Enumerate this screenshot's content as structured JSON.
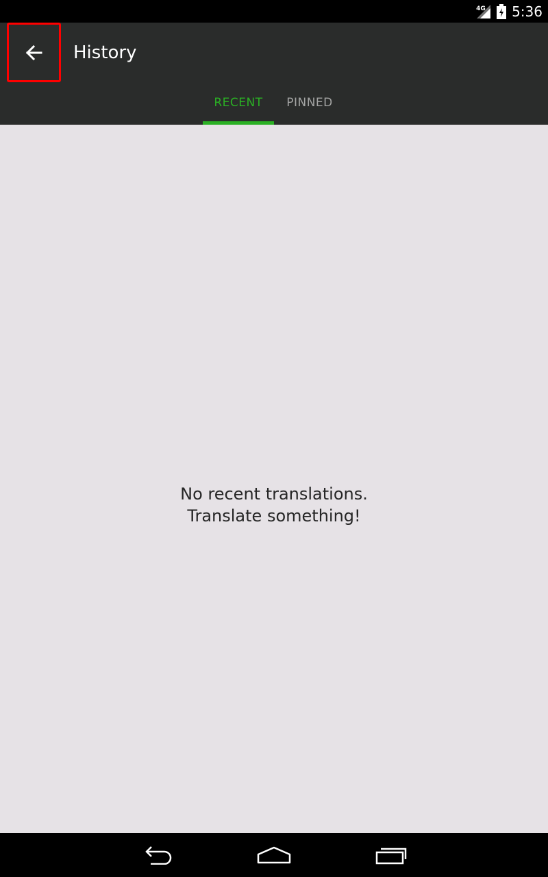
{
  "status_bar": {
    "time": "5:36",
    "network_type": "4G",
    "icons": [
      "signal-icon",
      "battery-icon"
    ]
  },
  "toolbar": {
    "title": "History",
    "back_icon": "arrow-back-icon"
  },
  "tabs": [
    {
      "label": "RECENT",
      "selected": true
    },
    {
      "label": "PINNED",
      "selected": false
    }
  ],
  "empty_state": {
    "line1": "No recent translations.",
    "line2": "Translate something!"
  },
  "nav_bar": {
    "icons": [
      "back-nav-icon",
      "home-nav-icon",
      "recents-nav-icon"
    ]
  },
  "colors": {
    "accent": "#2bb024",
    "toolbar_bg": "#2a2c2b",
    "content_bg": "#e6e2e6",
    "highlight_box": "#ff0000"
  }
}
